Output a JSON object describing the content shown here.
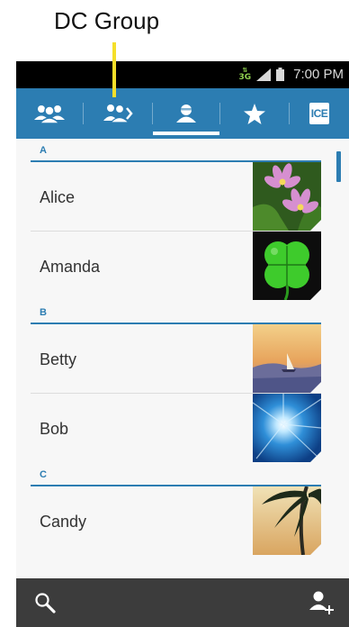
{
  "annotation": {
    "label": "DC Group"
  },
  "status_bar": {
    "network": "3G",
    "time": "7:00 PM"
  },
  "tabs": [
    {
      "id": "groups",
      "icon": "groups-icon"
    },
    {
      "id": "dc-group",
      "icon": "dc-group-icon"
    },
    {
      "id": "contacts",
      "icon": "contact-person-icon",
      "selected": true
    },
    {
      "id": "favorites",
      "icon": "star-icon"
    },
    {
      "id": "ice",
      "label": "ICE"
    }
  ],
  "sections": [
    {
      "letter": "A",
      "contacts": [
        {
          "name": "Alice",
          "photo": "pink-flowers"
        },
        {
          "name": "Amanda",
          "photo": "green-clover"
        }
      ]
    },
    {
      "letter": "B",
      "contacts": [
        {
          "name": "Betty",
          "photo": "sunset-sailboat"
        },
        {
          "name": "Bob",
          "photo": "blue-sunburst"
        }
      ]
    },
    {
      "letter": "C",
      "contacts": [
        {
          "name": "Candy",
          "photo": "palm-tree"
        }
      ]
    }
  ],
  "bottom_bar": {
    "left_icon": "search-icon",
    "right_icon": "add-contact-icon"
  },
  "colors": {
    "accent": "#2c7db2",
    "callout": "#f5df2a",
    "bottom_bar": "#3c3c3c"
  }
}
